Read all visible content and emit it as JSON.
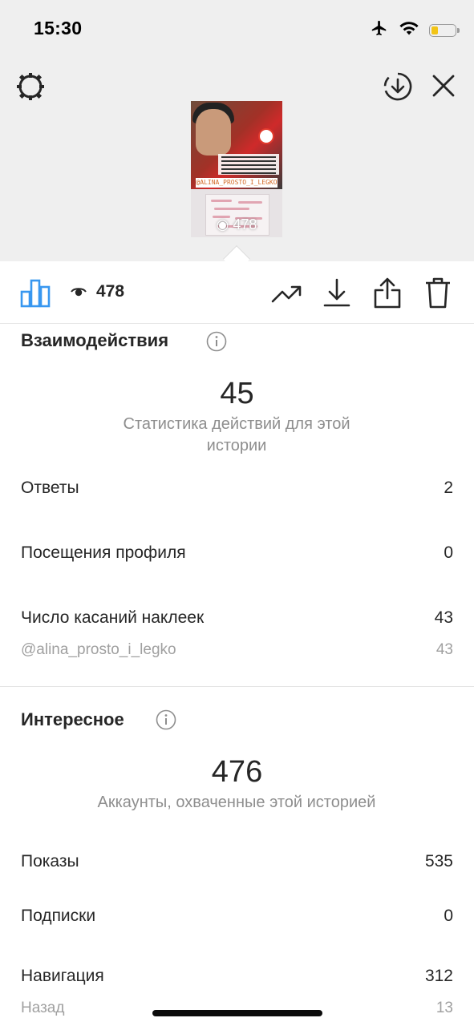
{
  "status_bar": {
    "time": "15:30",
    "icons": [
      "airplane-icon",
      "wifi-icon",
      "battery-icon"
    ],
    "battery_color": "#f2c416",
    "battery_level": 0.25
  },
  "header": {
    "left_icon": "settings-icon",
    "right_icons": [
      "save-circle-icon",
      "close-icon"
    ]
  },
  "story_thumbnail": {
    "tag_text": "@ALINA_PROSTO_I_LEGKO",
    "views_overlay": "478"
  },
  "toolbar": {
    "active_tab_icon": "bar-chart-icon",
    "views_icon": "eye-icon",
    "views_count": "478",
    "actions": [
      "trending-icon",
      "download-icon",
      "share-icon",
      "trash-icon"
    ],
    "accent_color": "#3897f0"
  },
  "interactions": {
    "title": "Взаимодействия",
    "total": "45",
    "caption": "Статистика действий для этой истории",
    "rows": [
      {
        "label": "Ответы",
        "value": "2"
      },
      {
        "label": "Посещения профиля",
        "value": "0"
      },
      {
        "label": "Число касаний наклеек",
        "value": "43"
      }
    ],
    "sub_row": {
      "label": "@alina_prosto_i_legko",
      "value": "43"
    }
  },
  "discovery": {
    "title": "Интересное",
    "total": "476",
    "caption": "Аккаунты, охваченные этой историей",
    "rows": [
      {
        "label": "Показы",
        "value": "535"
      },
      {
        "label": "Подписки",
        "value": "0"
      },
      {
        "label": "Навигация",
        "value": "312"
      }
    ],
    "sub_row": {
      "label": "Назад",
      "value": "13"
    }
  }
}
